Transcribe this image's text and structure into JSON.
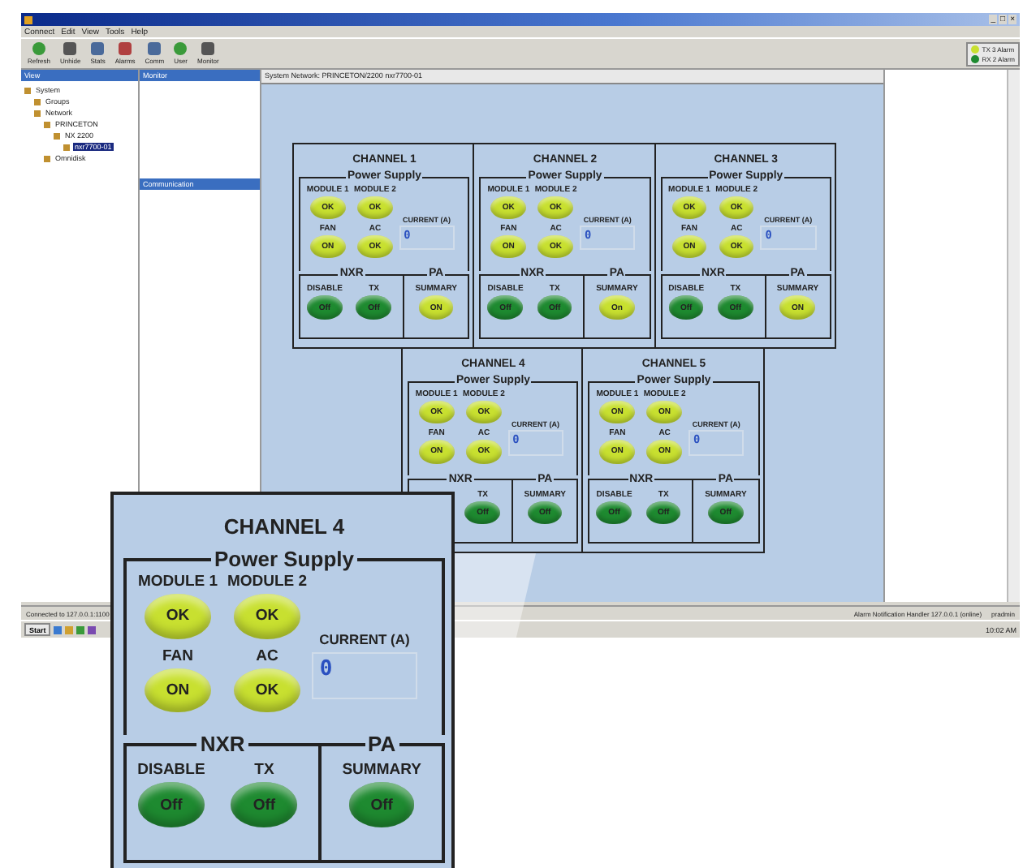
{
  "window": {
    "controls": [
      "_",
      "□",
      "×"
    ]
  },
  "menu": [
    "Connect",
    "Edit",
    "View",
    "Tools",
    "Help"
  ],
  "toolbar": [
    {
      "label": "Refresh",
      "kind": "refresh"
    },
    {
      "label": "Unhide",
      "kind": "drive"
    },
    {
      "label": "Stats",
      "kind": "grid"
    },
    {
      "label": "Alarms",
      "kind": "alarm"
    },
    {
      "label": "Comm",
      "kind": "grid"
    },
    {
      "label": "User",
      "kind": "user"
    },
    {
      "label": "Monitor",
      "kind": "drive"
    }
  ],
  "indicators": [
    {
      "label": "TX 3 Alarm",
      "color": "#c8e030"
    },
    {
      "label": "RX 2 Alarm",
      "color": "#1e8a30"
    }
  ],
  "panes": {
    "view": "View",
    "monitor": "Monitor",
    "communication": "Communication",
    "main_header": "System Network: PRINCETON/2200 nxr7700-01"
  },
  "tree": [
    {
      "label": "System",
      "selected": false,
      "children": [
        {
          "label": "Groups",
          "selected": false
        },
        {
          "label": "Network",
          "selected": false,
          "children": [
            {
              "label": "PRINCETON",
              "selected": false,
              "children": [
                {
                  "label": "NX 2200",
                  "selected": false,
                  "children": [
                    {
                      "label": "nxr7700-01",
                      "selected": true
                    }
                  ]
                }
              ]
            },
            {
              "label": "Omnidisk",
              "selected": false
            }
          ]
        }
      ]
    }
  ],
  "channels": [
    {
      "title": "CHANNEL 1",
      "power_title": "Power Supply",
      "leds": [
        {
          "label": "MODULE 1",
          "text": "OK",
          "color": "#c8e030"
        },
        {
          "label": "MODULE 2",
          "text": "OK",
          "color": "#c8e030"
        },
        {
          "label": "FAN",
          "text": "ON",
          "color": "#c8e030"
        },
        {
          "label": "AC",
          "text": "OK",
          "color": "#c8e030"
        }
      ],
      "current_label": "CURRENT (A)",
      "current": "0",
      "nxr_title": "NXR",
      "nxr": [
        {
          "label": "DISABLE",
          "text": "Off",
          "color": "#1e8a30"
        },
        {
          "label": "TX",
          "text": "Off",
          "color": "#1e8a30"
        }
      ],
      "pa_title": "PA",
      "pa": [
        {
          "label": "SUMMARY",
          "text": "ON",
          "color": "#c8e030"
        }
      ]
    },
    {
      "title": "CHANNEL 2",
      "power_title": "Power Supply",
      "leds": [
        {
          "label": "MODULE 1",
          "text": "OK",
          "color": "#c8e030"
        },
        {
          "label": "MODULE 2",
          "text": "OK",
          "color": "#c8e030"
        },
        {
          "label": "FAN",
          "text": "ON",
          "color": "#c8e030"
        },
        {
          "label": "AC",
          "text": "OK",
          "color": "#c8e030"
        }
      ],
      "current_label": "CURRENT (A)",
      "current": "0",
      "nxr_title": "NXR",
      "nxr": [
        {
          "label": "DISABLE",
          "text": "Off",
          "color": "#1e8a30"
        },
        {
          "label": "TX",
          "text": "Off",
          "color": "#1e8a30"
        }
      ],
      "pa_title": "PA",
      "pa": [
        {
          "label": "SUMMARY",
          "text": "On",
          "color": "#c8e030"
        }
      ]
    },
    {
      "title": "CHANNEL 3",
      "power_title": "Power Supply",
      "leds": [
        {
          "label": "MODULE 1",
          "text": "OK",
          "color": "#c8e030"
        },
        {
          "label": "MODULE 2",
          "text": "OK",
          "color": "#c8e030"
        },
        {
          "label": "FAN",
          "text": "ON",
          "color": "#c8e030"
        },
        {
          "label": "AC",
          "text": "OK",
          "color": "#c8e030"
        }
      ],
      "current_label": "CURRENT (A)",
      "current": "0",
      "nxr_title": "NXR",
      "nxr": [
        {
          "label": "DISABLE",
          "text": "Off",
          "color": "#1e8a30"
        },
        {
          "label": "TX",
          "text": "Off",
          "color": "#1e8a30"
        }
      ],
      "pa_title": "PA",
      "pa": [
        {
          "label": "SUMMARY",
          "text": "ON",
          "color": "#c8e030"
        }
      ]
    },
    {
      "title": "CHANNEL 4",
      "power_title": "Power Supply",
      "leds": [
        {
          "label": "MODULE 1",
          "text": "OK",
          "color": "#c8e030"
        },
        {
          "label": "MODULE 2",
          "text": "OK",
          "color": "#c8e030"
        },
        {
          "label": "FAN",
          "text": "ON",
          "color": "#c8e030"
        },
        {
          "label": "AC",
          "text": "OK",
          "color": "#c8e030"
        }
      ],
      "current_label": "CURRENT (A)",
      "current": "0",
      "nxr_title": "NXR",
      "nxr": [
        {
          "label": "TX",
          "text": "Off",
          "color": "#1e8a30"
        }
      ],
      "pa_title": "PA",
      "pa": [
        {
          "label": "SUMMARY",
          "text": "Off",
          "color": "#1e8a30"
        }
      ]
    },
    {
      "title": "CHANNEL 5",
      "power_title": "Power Supply",
      "leds": [
        {
          "label": "MODULE 1",
          "text": "ON",
          "color": "#c8e030"
        },
        {
          "label": "MODULE 2",
          "text": "ON",
          "color": "#c8e030"
        },
        {
          "label": "FAN",
          "text": "ON",
          "color": "#c8e030"
        },
        {
          "label": "AC",
          "text": "ON",
          "color": "#c8e030"
        }
      ],
      "current_label": "CURRENT (A)",
      "current": "0",
      "nxr_title": "NXR",
      "nxr": [
        {
          "label": "DISABLE",
          "text": "Off",
          "color": "#1e8a30"
        },
        {
          "label": "TX",
          "text": "Off",
          "color": "#1e8a30"
        }
      ],
      "pa_title": "PA",
      "pa": [
        {
          "label": "SUMMARY",
          "text": "Off",
          "color": "#1e8a30"
        }
      ]
    }
  ],
  "callout": {
    "title": "CHANNEL 4",
    "power_title": "Power Supply",
    "leds": [
      {
        "label": "MODULE 1",
        "text": "OK",
        "color": "#c8e030"
      },
      {
        "label": "MODULE 2",
        "text": "OK",
        "color": "#c8e030"
      },
      {
        "label": "FAN",
        "text": "ON",
        "color": "#c8e030"
      },
      {
        "label": "AC",
        "text": "OK",
        "color": "#c8e030"
      }
    ],
    "current_label": "CURRENT (A)",
    "current": "0",
    "nxr_title": "NXR",
    "nxr": [
      {
        "label": "DISABLE",
        "text": "Off",
        "color": "#1e8a30"
      },
      {
        "label": "TX",
        "text": "Off",
        "color": "#1e8a30"
      }
    ],
    "pa_title": "PA",
    "pa": [
      {
        "label": "SUMMARY",
        "text": "Off",
        "color": "#1e8a30"
      }
    ]
  },
  "status_bar": {
    "left": "Connected to 127.0.0.1:1100",
    "right": "Alarm Notification Handler 127.0.0.1 (online)",
    "user": "pradmin"
  },
  "taskbar": {
    "start": "Start",
    "time": "10:02 AM"
  }
}
